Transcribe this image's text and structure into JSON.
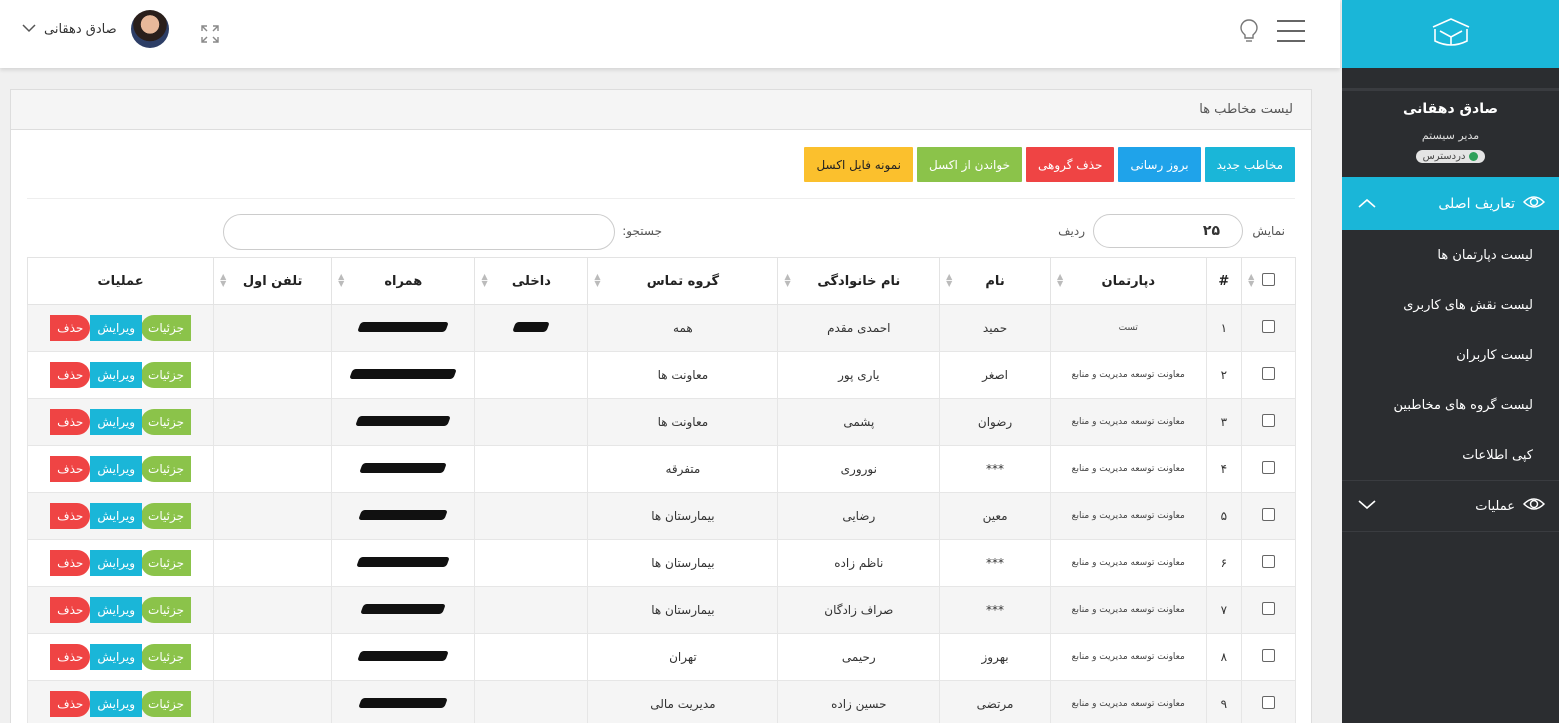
{
  "sidebar": {
    "user_name": "صادق دهقانی",
    "user_role": "مدیر سیستم",
    "status": "دردسترس",
    "menu_main": "تعاریف اصلی",
    "sub_items": [
      "لیست دپارتمان ها",
      "لیست نقش های کاربری",
      "لیست کاربران",
      "لیست گروه های مخاطبین",
      "کپی اطلاعات"
    ],
    "menu_ops": "عملیات"
  },
  "topbar": {
    "user_name": "صادق دهقانی"
  },
  "panel": {
    "title": "لیست مخاطب ها",
    "buttons": {
      "new": "مخاطب جدید",
      "update": "بروز رسانی",
      "bulk_delete": "حذف گروهی",
      "import_excel": "خواندن از اکسل",
      "sample_excel": "نمونه فایل اکسل"
    },
    "show_label": "نمایش",
    "page_length": "۲۵",
    "row_label": "ردیف",
    "search_label": "جستجو:"
  },
  "table": {
    "headers": {
      "num": "#",
      "dept": "دپارتمان",
      "first": "نام",
      "last": "نام خانوادگی",
      "group": "گروه تماس",
      "ext": "داخلی",
      "mobile": "همراه",
      "phone": "تلفن اول",
      "ops": "عملیات"
    },
    "op_labels": {
      "details": "جزئیات",
      "edit": "ویرایش",
      "delete": "حذف"
    },
    "rows": [
      {
        "num": "۱",
        "dept": "تست",
        "first": "حمید",
        "last": "احمدی مقدم",
        "group": "همه"
      },
      {
        "num": "۲",
        "dept": "معاونت توسعه مدیریت و منابع",
        "first": "اصغر",
        "last": "یاری پور",
        "group": "معاونت ها"
      },
      {
        "num": "۳",
        "dept": "معاونت توسعه مدیریت و منابع",
        "first": "رضوان",
        "last": "پشمی",
        "group": "معاونت ها"
      },
      {
        "num": "۴",
        "dept": "معاونت توسعه مدیریت و منابع",
        "first": "***",
        "last": "نوروری",
        "group": "متفرقه"
      },
      {
        "num": "۵",
        "dept": "معاونت توسعه مدیریت و منابع",
        "first": "معین",
        "last": "رضایی",
        "group": "بیمارستان ها"
      },
      {
        "num": "۶",
        "dept": "معاونت توسعه مدیریت و منابع",
        "first": "***",
        "last": "ناظم زاده",
        "group": "بیمارستان ها"
      },
      {
        "num": "۷",
        "dept": "معاونت توسعه مدیریت و منابع",
        "first": "***",
        "last": "صراف زادگان",
        "group": "بیمارستان ها"
      },
      {
        "num": "۸",
        "dept": "معاونت توسعه مدیریت و منابع",
        "first": "بهروز",
        "last": "رحیمی",
        "group": "تهران"
      },
      {
        "num": "۹",
        "dept": "معاونت توسعه مدیریت و منابع",
        "first": "مرتضی",
        "last": "حسین زاده",
        "group": "مدیریت مالی"
      }
    ]
  },
  "colors": {
    "accent": "#1ab6d8",
    "sidebar_bg": "#2b2d30",
    "danger": "#ef4444",
    "success": "#8bc34a",
    "warning": "#fbc02d",
    "primary": "#1fa3ea"
  },
  "icons": [
    "menu-icon",
    "bulb-icon",
    "expand-icon",
    "chevron-down-icon",
    "logo-icon",
    "eye-icon",
    "chevron-up-icon"
  ]
}
